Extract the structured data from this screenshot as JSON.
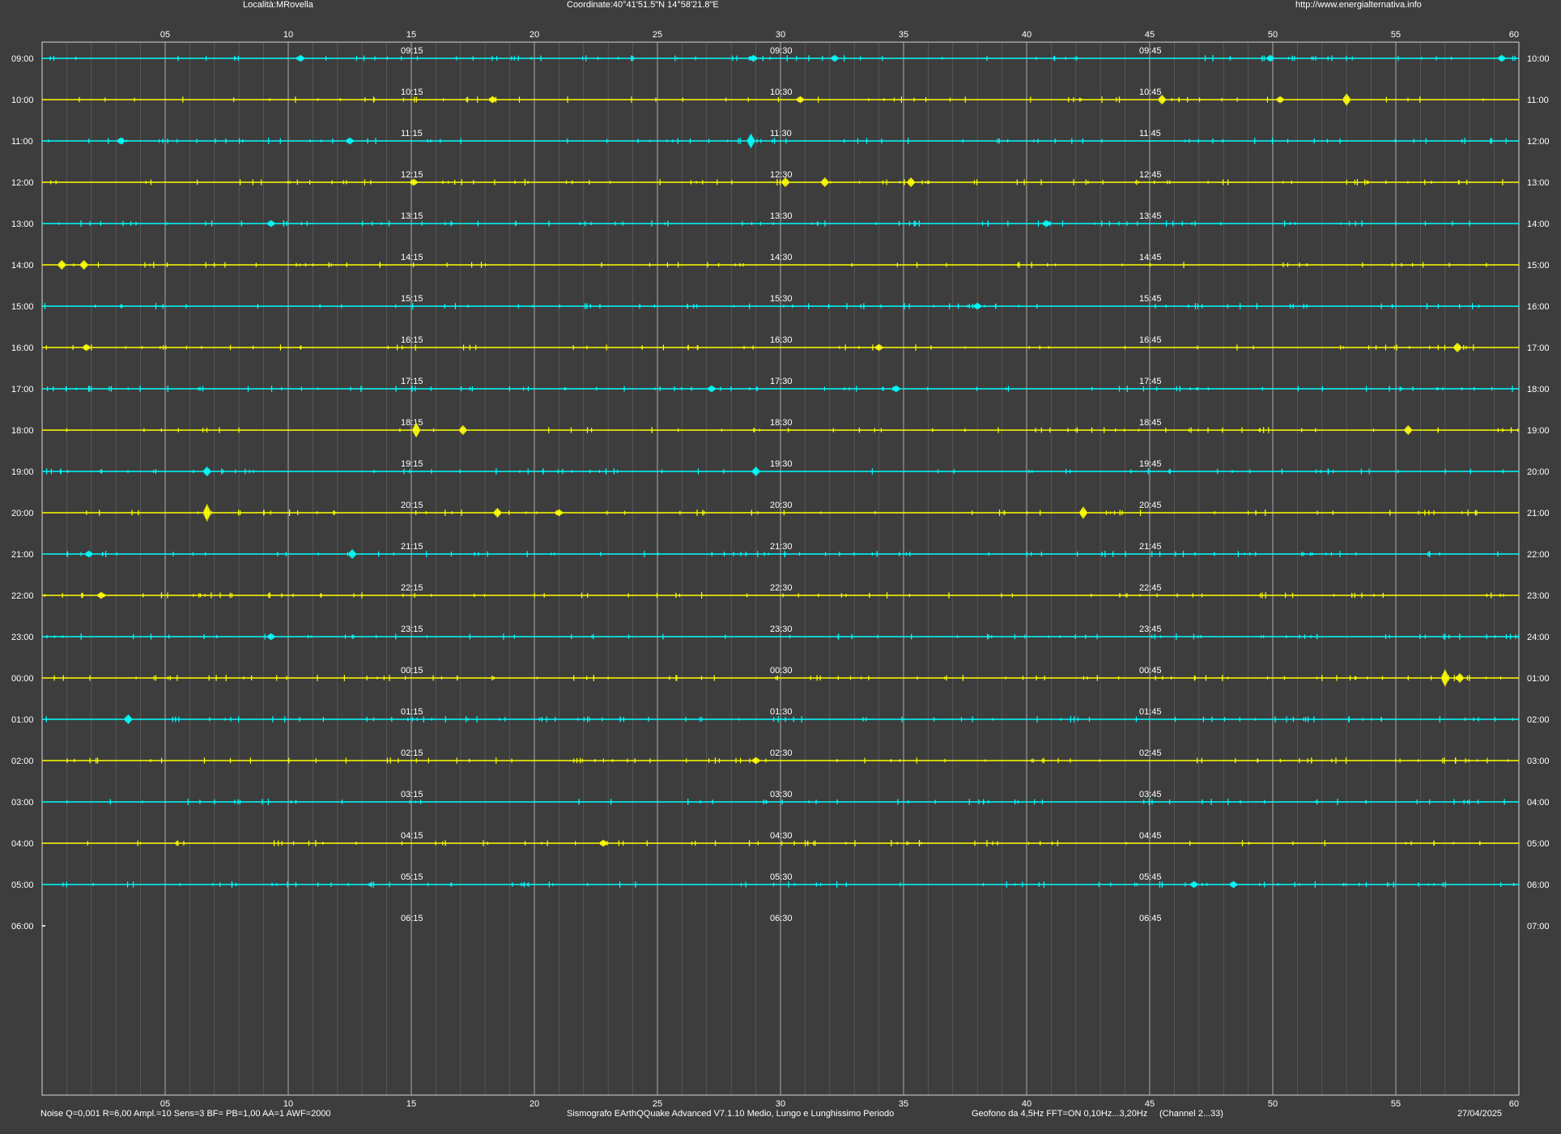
{
  "header": {
    "location": "Località:MRovella",
    "coordinates": "Coordinate:40°41'51.5\"N 14°58'21.8\"E",
    "url": "http://www.energialternativa.info"
  },
  "footer": {
    "params": "Noise Q=0,001 R=6,00 Ampl.=10 Sens=3 BF= PB=1,00 AA=1 AWF=2000",
    "software": "Sismografo  EArthQQuake Advanced V7.1.10  Medio, Lungo e Lunghissimo Periodo",
    "sensor": "Geofono da 4,5Hz FFT=ON 0,10Hz...3,20Hz",
    "channels": "(Channel 2...33)",
    "date": "27/04/2025"
  },
  "colors": {
    "background": "#3d3d3d",
    "border": "#d8d8d8",
    "grid_major": "#b8b8b8",
    "grid_minor": "#6a6a6a",
    "trace_cyan": "#00ffff",
    "trace_yellow": "#ffff00",
    "trace_last": "#ffffff",
    "text": "#ffffff"
  },
  "chart_data": {
    "type": "line",
    "x_unit": "minutes",
    "xlim": [
      0,
      60
    ],
    "x_tick_labels": [
      "05",
      "10",
      "15",
      "20",
      "25",
      "30",
      "35",
      "40",
      "45",
      "50",
      "55",
      "60"
    ],
    "minute_markers": [
      15,
      30,
      45
    ],
    "rows": [
      {
        "left": "09:00",
        "right": "10:00",
        "marks": [
          "09:15",
          "09:30",
          "09:45"
        ],
        "color": "cyan"
      },
      {
        "left": "10:00",
        "right": "11:00",
        "marks": [
          "10:15",
          "10:30",
          "10:45"
        ],
        "color": "yellow"
      },
      {
        "left": "11:00",
        "right": "12:00",
        "marks": [
          "11:15",
          "11:30",
          "11:45"
        ],
        "color": "cyan"
      },
      {
        "left": "12:00",
        "right": "13:00",
        "marks": [
          "12:15",
          "12:30",
          "12:45"
        ],
        "color": "yellow"
      },
      {
        "left": "13:00",
        "right": "14:00",
        "marks": [
          "13:15",
          "13:30",
          "13:45"
        ],
        "color": "cyan"
      },
      {
        "left": "14:00",
        "right": "15:00",
        "marks": [
          "14:15",
          "14:30",
          "14:45"
        ],
        "color": "yellow"
      },
      {
        "left": "15:00",
        "right": "16:00",
        "marks": [
          "15:15",
          "15:30",
          "15:45"
        ],
        "color": "cyan"
      },
      {
        "left": "16:00",
        "right": "17:00",
        "marks": [
          "16:15",
          "16:30",
          "16:45"
        ],
        "color": "yellow"
      },
      {
        "left": "17:00",
        "right": "18:00",
        "marks": [
          "17:15",
          "17:30",
          "17:45"
        ],
        "color": "cyan"
      },
      {
        "left": "18:00",
        "right": "19:00",
        "marks": [
          "18:15",
          "18:30",
          "18:45"
        ],
        "color": "yellow"
      },
      {
        "left": "19:00",
        "right": "20:00",
        "marks": [
          "19:15",
          "19:30",
          "19:45"
        ],
        "color": "cyan"
      },
      {
        "left": "20:00",
        "right": "21:00",
        "marks": [
          "20:15",
          "20:30",
          "20:45"
        ],
        "color": "yellow"
      },
      {
        "left": "21:00",
        "right": "22:00",
        "marks": [
          "21:15",
          "21:30",
          "21:45"
        ],
        "color": "cyan"
      },
      {
        "left": "22:00",
        "right": "23:00",
        "marks": [
          "22:15",
          "22:30",
          "22:45"
        ],
        "color": "yellow"
      },
      {
        "left": "23:00",
        "right": "24:00",
        "marks": [
          "23:15",
          "23:30",
          "23:45"
        ],
        "color": "cyan"
      },
      {
        "left": "00:00",
        "right": "01:00",
        "marks": [
          "00:15",
          "00:30",
          "00:45"
        ],
        "color": "yellow"
      },
      {
        "left": "01:00",
        "right": "02:00",
        "marks": [
          "01:15",
          "01:30",
          "01:45"
        ],
        "color": "cyan"
      },
      {
        "left": "02:00",
        "right": "03:00",
        "marks": [
          "02:15",
          "02:30",
          "02:45"
        ],
        "color": "yellow"
      },
      {
        "left": "03:00",
        "right": "04:00",
        "marks": [
          "03:15",
          "03:30",
          "03:45"
        ],
        "color": "cyan"
      },
      {
        "left": "04:00",
        "right": "05:00",
        "marks": [
          "04:15",
          "04:30",
          "04:45"
        ],
        "color": "yellow"
      },
      {
        "left": "05:00",
        "right": "06:00",
        "marks": [
          "05:15",
          "05:30",
          "05:45"
        ],
        "color": "cyan"
      },
      {
        "left": "06:00",
        "right": "07:00",
        "marks": [
          "06:15",
          "06:30",
          "06:45"
        ],
        "color": "white"
      }
    ],
    "events": [
      {
        "row": 0,
        "minute": 10.5,
        "amp": 2
      },
      {
        "row": 0,
        "minute": 28.9,
        "amp": 2
      },
      {
        "row": 0,
        "minute": 32.2,
        "amp": 2
      },
      {
        "row": 0,
        "minute": 49.9,
        "amp": 2
      },
      {
        "row": 0,
        "minute": 59.3,
        "amp": 2
      },
      {
        "row": 1,
        "minute": 18.3,
        "amp": 2
      },
      {
        "row": 1,
        "minute": 30.8,
        "amp": 2
      },
      {
        "row": 1,
        "minute": 45.5,
        "amp": 3
      },
      {
        "row": 1,
        "minute": 53.0,
        "amp": 4
      },
      {
        "row": 1,
        "minute": 50.3,
        "amp": 2
      },
      {
        "row": 2,
        "minute": 28.8,
        "amp": 5
      },
      {
        "row": 2,
        "minute": 12.5,
        "amp": 2
      },
      {
        "row": 2,
        "minute": 3.2,
        "amp": 2
      },
      {
        "row": 3,
        "minute": 30.2,
        "amp": 3
      },
      {
        "row": 3,
        "minute": 31.8,
        "amp": 3
      },
      {
        "row": 3,
        "minute": 35.3,
        "amp": 3
      },
      {
        "row": 3,
        "minute": 15.1,
        "amp": 2
      },
      {
        "row": 4,
        "minute": 9.3,
        "amp": 2
      },
      {
        "row": 4,
        "minute": 40.8,
        "amp": 2
      },
      {
        "row": 5,
        "minute": 0.8,
        "amp": 3
      },
      {
        "row": 5,
        "minute": 1.7,
        "amp": 3
      },
      {
        "row": 6,
        "minute": 38.0,
        "amp": 2
      },
      {
        "row": 7,
        "minute": 1.8,
        "amp": 2
      },
      {
        "row": 7,
        "minute": 34.0,
        "amp": 2
      },
      {
        "row": 7,
        "minute": 57.5,
        "amp": 3
      },
      {
        "row": 8,
        "minute": 27.2,
        "amp": 2
      },
      {
        "row": 8,
        "minute": 34.7,
        "amp": 2
      },
      {
        "row": 9,
        "minute": 15.2,
        "amp": 5
      },
      {
        "row": 9,
        "minute": 17.1,
        "amp": 3
      },
      {
        "row": 9,
        "minute": 55.5,
        "amp": 3
      },
      {
        "row": 10,
        "minute": 6.7,
        "amp": 3
      },
      {
        "row": 10,
        "minute": 29.0,
        "amp": 3
      },
      {
        "row": 11,
        "minute": 6.7,
        "amp": 6
      },
      {
        "row": 11,
        "minute": 18.5,
        "amp": 3
      },
      {
        "row": 11,
        "minute": 42.3,
        "amp": 4
      },
      {
        "row": 11,
        "minute": 21.0,
        "amp": 2
      },
      {
        "row": 12,
        "minute": 12.6,
        "amp": 3
      },
      {
        "row": 12,
        "minute": 1.9,
        "amp": 2
      },
      {
        "row": 13,
        "minute": 2.4,
        "amp": 2
      },
      {
        "row": 14,
        "minute": 9.3,
        "amp": 2
      },
      {
        "row": 15,
        "minute": 57.0,
        "amp": 6
      },
      {
        "row": 15,
        "minute": 57.6,
        "amp": 3
      },
      {
        "row": 16,
        "minute": 3.5,
        "amp": 3
      },
      {
        "row": 17,
        "minute": 29.0,
        "amp": 2
      },
      {
        "row": 19,
        "minute": 22.8,
        "amp": 2
      },
      {
        "row": 20,
        "minute": 46.8,
        "amp": 2
      },
      {
        "row": 20,
        "minute": 48.4,
        "amp": 2
      }
    ]
  }
}
